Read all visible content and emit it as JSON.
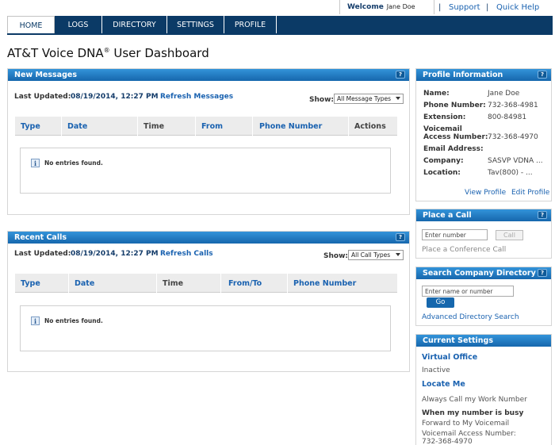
{
  "topbar": {
    "welcome_label": "Welcome",
    "user_name": "Jane Doe",
    "separator": "|",
    "support": "Support",
    "quick_help": "Quick Help"
  },
  "nav": {
    "tabs": [
      {
        "label": "HOME",
        "active": true
      },
      {
        "label": "LOGS",
        "active": false
      },
      {
        "label": "DIRECTORY",
        "active": false
      },
      {
        "label": "SETTINGS",
        "active": false
      },
      {
        "label": "PROFILE",
        "active": false
      }
    ]
  },
  "page": {
    "title_main": "AT&T Voice DNA",
    "title_reg": "®",
    "title_rest": " User Dashboard"
  },
  "new_messages": {
    "title": "New Messages",
    "help": "?",
    "last_updated_label": "Last Updated:",
    "last_updated_value": "08/19/2014, 12:27 PM",
    "refresh": "Refresh Messages",
    "show_label": "Show:",
    "show_value": "All Message Types",
    "columns": [
      "Type",
      "Date",
      "Time",
      "From",
      "Phone Number",
      "Actions"
    ],
    "empty_message": "No entries found."
  },
  "recent_calls": {
    "title": "Recent Calls",
    "help": "?",
    "last_updated_label": "Last Updated:",
    "last_updated_value": "08/19/2014, 12:27 PM",
    "refresh": "Refresh Calls",
    "show_label": "Show:",
    "show_value": "All Call Types",
    "columns": [
      "Type",
      "Date",
      "Time",
      "From/To",
      "Phone Number"
    ],
    "empty_message": "No entries found."
  },
  "profile": {
    "title": "Profile Information",
    "help": "?",
    "name_label": "Name:",
    "name_value": "Jane Doe",
    "phone_label": "Phone Number:",
    "phone_value": "732-368-4981",
    "extension_label": "Extension:",
    "extension_value": "800-84981",
    "voicemail_label_1": "Voicemail",
    "voicemail_label_2": "Access Number:",
    "voicemail_value": "732-368-4970",
    "email_label": "Email Address:",
    "email_value": "",
    "company_label": "Company:",
    "company_value": "SASVP VDNA ...",
    "location_label": "Location:",
    "location_value": "Tav(800) - ...",
    "view_profile": "View Profile",
    "edit_profile": "Edit Profile"
  },
  "place_call": {
    "title": "Place a Call",
    "help": "?",
    "input_placeholder": "Enter number",
    "call_button": "Call",
    "conference": "Place a Conference Call"
  },
  "search_directory": {
    "title": "Search Company Directory",
    "help": "?",
    "input_placeholder": "Enter name or number",
    "go_button": "Go",
    "advanced": "Advanced Directory Search"
  },
  "current_settings": {
    "title": "Current Settings",
    "virtual_office": "Virtual Office",
    "virtual_office_status": "Inactive",
    "locate_me": "Locate Me",
    "locate_me_status": "Always Call my Work Number",
    "busy_label": "When my number is busy",
    "busy_value": "Forward to My Voicemail",
    "voicemail_label": "Voicemail Access Number:",
    "voicemail_value": "732-368-4970"
  }
}
